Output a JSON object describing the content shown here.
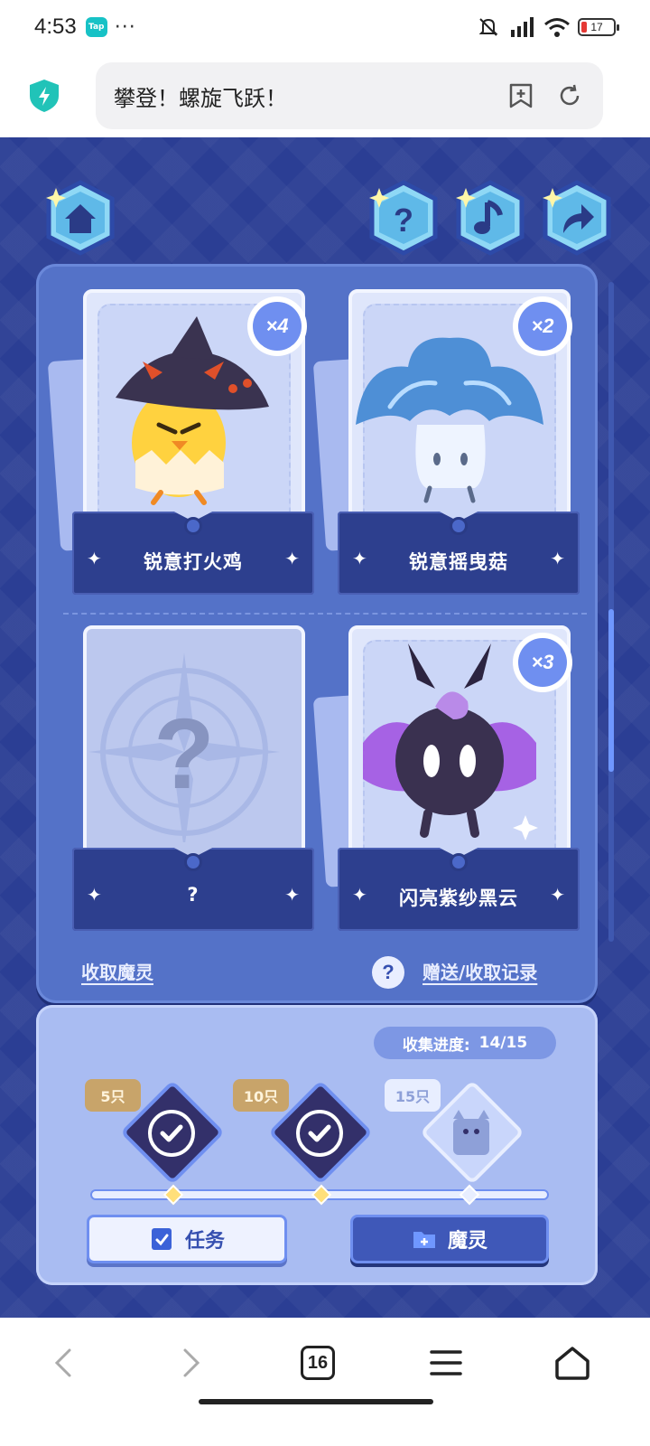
{
  "status_bar": {
    "time": "4:53",
    "app_badge": "Tap",
    "more": "···",
    "battery": "17",
    "icons": [
      "mute-icon",
      "signal-icon",
      "wifi-icon",
      "battery-icon"
    ]
  },
  "browser": {
    "page_title": "攀登！螺旋飞跃！",
    "tab_count": "16"
  },
  "game": {
    "top_buttons": [
      "home-icon",
      "help-icon",
      "music-icon",
      "share-icon"
    ],
    "cards": [
      {
        "name": "锐意打火鸡",
        "count": "×4"
      },
      {
        "name": "锐意摇曳菇",
        "count": "×2"
      },
      {
        "name": "?",
        "count": ""
      },
      {
        "name": "闪亮紫纱黑云",
        "count": "×3"
      }
    ],
    "links": {
      "collect": "收取魔灵",
      "records": "赠送/收取记录"
    },
    "progress": {
      "label": "收集进度:",
      "value": "14/15",
      "collected": 14,
      "total": 15
    },
    "milestones": [
      {
        "label": "5只",
        "claimed": true
      },
      {
        "label": "10只",
        "claimed": true
      },
      {
        "label": "15只",
        "claimed": false
      }
    ],
    "buttons": {
      "task": "任务",
      "spirit": "魔灵"
    }
  },
  "colors": {
    "game_bg": "#2b3e94",
    "panel": "#5472c8",
    "accent": "#6f8ff0",
    "gold": "#c8a46a"
  }
}
